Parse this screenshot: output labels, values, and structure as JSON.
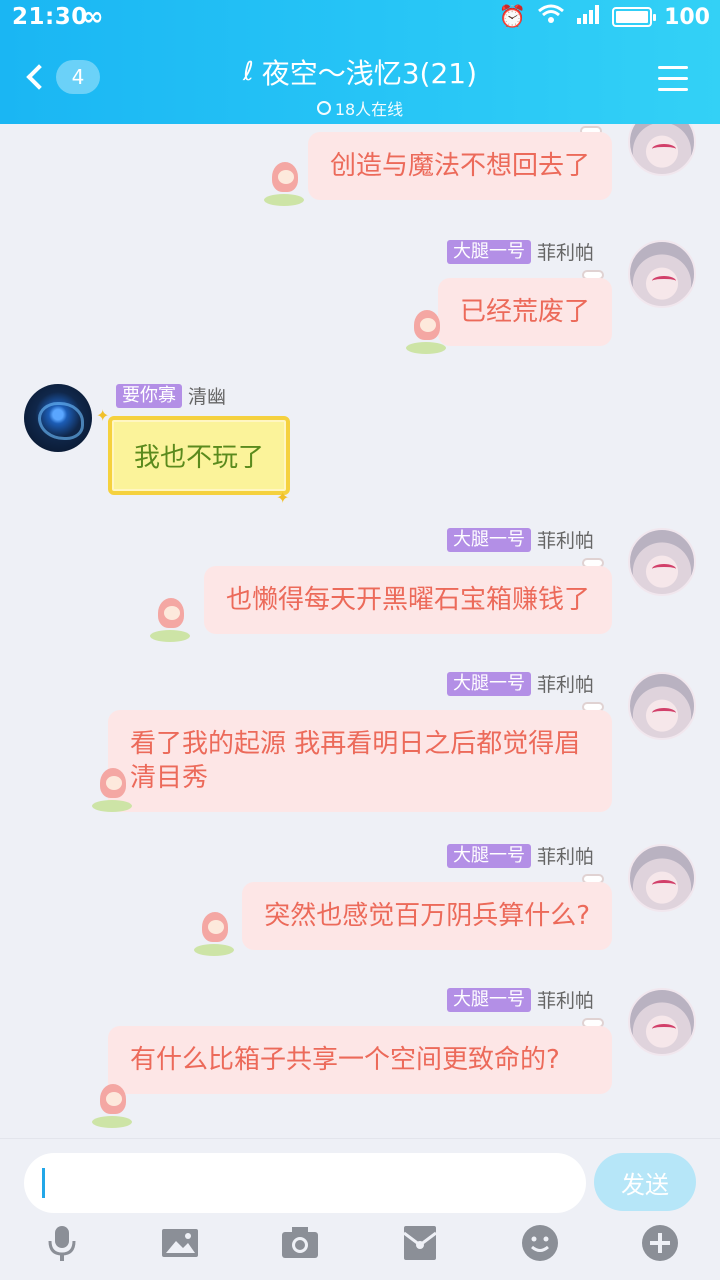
{
  "status": {
    "time": "21:30",
    "battery": "100"
  },
  "header": {
    "back_count": "4",
    "title": "夜空～浅忆3(21)",
    "online": "18人在线"
  },
  "messages": [
    {
      "side": "right",
      "tag": "",
      "name": "",
      "text": "创造与魔法不想回去了"
    },
    {
      "side": "right",
      "tag": "大腿一号",
      "name": "菲利帕",
      "text": "已经荒废了"
    },
    {
      "side": "left",
      "tag": "要你寡",
      "name": "清幽",
      "text": "我也不玩了"
    },
    {
      "side": "right",
      "tag": "大腿一号",
      "name": "菲利帕",
      "text": "也懒得每天开黑曜石宝箱赚钱了"
    },
    {
      "side": "right",
      "tag": "大腿一号",
      "name": "菲利帕",
      "text": "看了我的起源 我再看明日之后都觉得眉清目秀"
    },
    {
      "side": "right",
      "tag": "大腿一号",
      "name": "菲利帕",
      "text": "突然也感觉百万阴兵算什么?"
    },
    {
      "side": "right",
      "tag": "大腿一号",
      "name": "菲利帕",
      "text": "有什么比箱子共享一个空间更致命的?"
    }
  ],
  "input": {
    "value": "",
    "send_label": "发送"
  },
  "icons": [
    "microphone-icon",
    "image-icon",
    "camera-icon",
    "red-packet-icon",
    "emoji-icon",
    "plus-icon"
  ],
  "colors": {
    "header": "#1ab6f3",
    "bubble": "#fde6e6",
    "bubble_text": "#ec6a5a",
    "tag": "#b38fe6",
    "send": "#b6e6f8"
  }
}
